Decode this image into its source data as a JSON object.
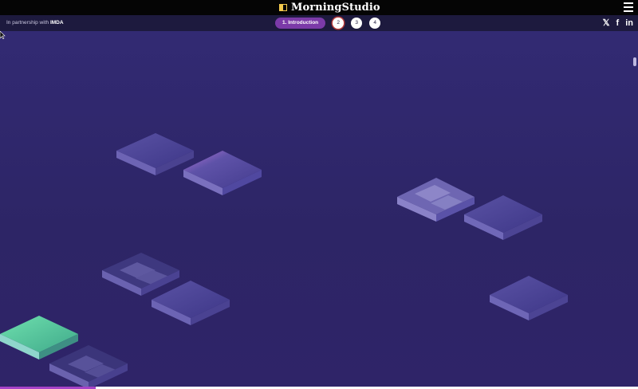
{
  "header": {
    "logo_text": "MorningStudio",
    "partner_prefix": "In partnership with",
    "partner_name": "IMDA"
  },
  "steps": [
    {
      "label": "1. Introduction",
      "active": true
    },
    {
      "label": "2",
      "active": false
    },
    {
      "label": "3",
      "active": false
    },
    {
      "label": "4",
      "active": false
    }
  ],
  "social": {
    "x_glyph": "𝕏",
    "facebook_glyph": "f",
    "linkedin_glyph": "in"
  },
  "icons": [
    "logo-icon",
    "hamburger-menu-icon",
    "x-icon",
    "facebook-icon",
    "linkedin-icon",
    "cursor-icon"
  ],
  "colors": {
    "background": "#2b2366",
    "step_active": "#7b3aa8",
    "tile_highlight_green": "#5fd0a0",
    "progress": "#a742c8"
  }
}
